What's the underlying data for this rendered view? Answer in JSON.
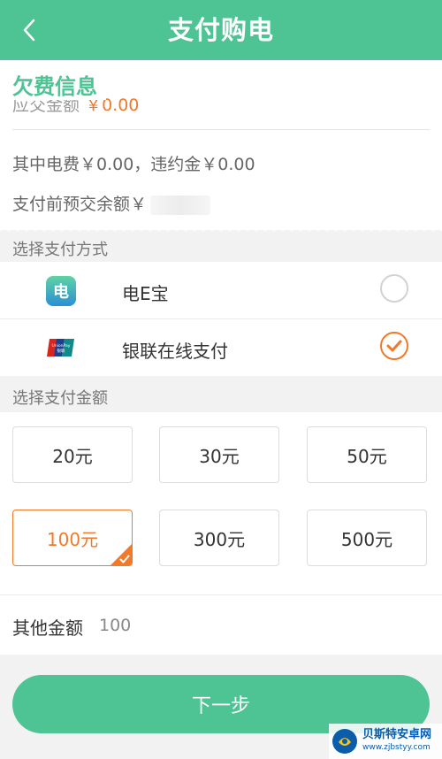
{
  "header": {
    "title": "支付购电"
  },
  "arrears": {
    "heading": "欠费信息",
    "amount_label": "应交金额",
    "amount_value": "￥0.00",
    "detail": "其中电费￥0.00，违约金￥0.00",
    "prepaid_label": "支付前预交余额￥"
  },
  "payment": {
    "section_label": "选择支付方式",
    "methods": [
      {
        "name": "电E宝",
        "icon": "dianebao-icon",
        "selected": false
      },
      {
        "name": "银联在线支付",
        "icon": "unionpay-icon",
        "selected": true
      }
    ]
  },
  "amounts": {
    "section_label": "选择支付金额",
    "options": [
      "20元",
      "30元",
      "50元",
      "100元",
      "300元",
      "500元"
    ],
    "selected": "100元"
  },
  "other": {
    "label": "其他金额",
    "value": "100"
  },
  "next_button": "下一步",
  "watermark": {
    "cn": "贝斯特安卓网",
    "url": "www.zjbstyy.com"
  },
  "colors": {
    "primary": "#4ec394",
    "accent": "#f07a2a"
  }
}
